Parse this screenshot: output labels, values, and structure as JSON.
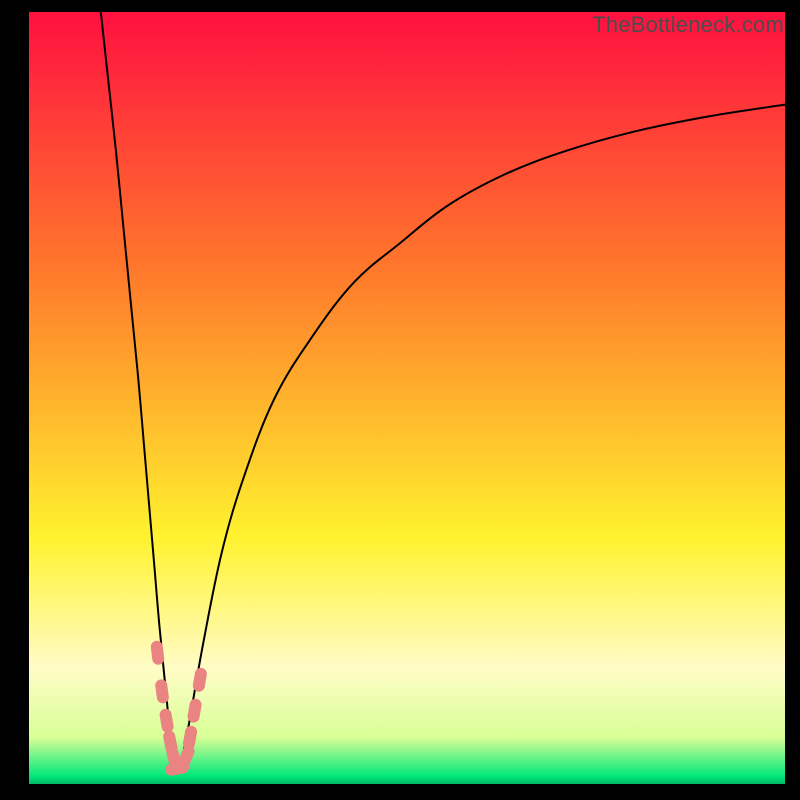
{
  "watermark": "TheBottleneck.com",
  "chart_data": {
    "type": "line",
    "title": "",
    "xlabel": "",
    "ylabel": "",
    "xlim": [
      0,
      100
    ],
    "ylim": [
      0,
      100
    ],
    "grid": false,
    "legend": false,
    "background": {
      "type": "vertical-gradient",
      "stops": [
        {
          "offset": 0.0,
          "color": "#ff1040"
        },
        {
          "offset": 0.34,
          "color": "#ff7a2b"
        },
        {
          "offset": 0.68,
          "color": "#fff22e"
        },
        {
          "offset": 0.85,
          "color": "#fffcc6"
        },
        {
          "offset": 0.94,
          "color": "#d8ff96"
        },
        {
          "offset": 0.99,
          "color": "#00e87a"
        },
        {
          "offset": 1.0,
          "color": "#00b864"
        }
      ]
    },
    "series": [
      {
        "name": "left-branch",
        "color": "#000000",
        "x": [
          9.5,
          10.5,
          11.5,
          12.5,
          13.5,
          14.5,
          15.2,
          15.9,
          16.6,
          17.2,
          17.9,
          18.5,
          19.0
        ],
        "y": [
          100,
          91,
          82,
          72,
          62,
          52,
          44,
          36,
          28,
          21,
          14,
          8,
          2
        ]
      },
      {
        "name": "right-branch",
        "color": "#000000",
        "x": [
          20.0,
          21.2,
          23.0,
          25.5,
          28.5,
          32.5,
          37.5,
          43.0,
          49.0,
          55.5,
          63.0,
          71.0,
          80.0,
          90.0,
          100.0
        ],
        "y": [
          2,
          8,
          18,
          30,
          40,
          50,
          58,
          65,
          70,
          75,
          79,
          82,
          84.5,
          86.5,
          88
        ]
      },
      {
        "name": "valley-markers",
        "type": "scatter",
        "color": "#e98483",
        "marker_shape": "rounded-capsule",
        "x": [
          17.0,
          17.6,
          18.2,
          18.7,
          19.2,
          19.6,
          20.8,
          21.3,
          21.9,
          22.6
        ],
        "y": [
          17.0,
          12.0,
          8.2,
          5.4,
          3.2,
          2.0,
          3.5,
          6.0,
          9.5,
          13.5
        ]
      }
    ]
  }
}
